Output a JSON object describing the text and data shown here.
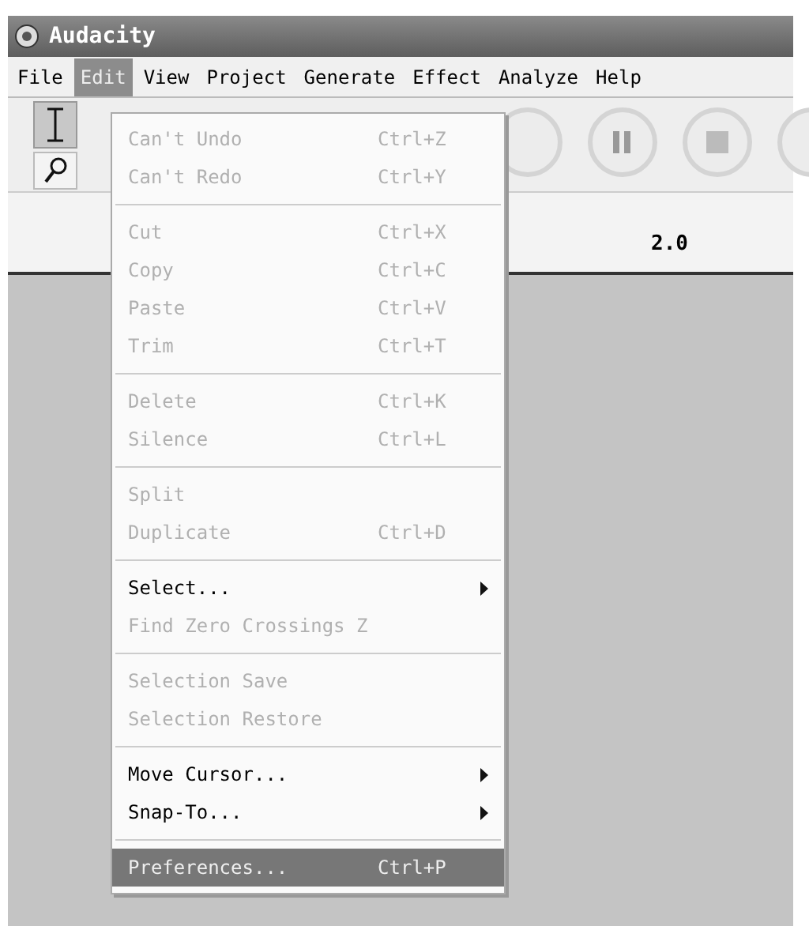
{
  "window": {
    "title": "Audacity"
  },
  "menu_bar": [
    {
      "label": "File",
      "selected": false
    },
    {
      "label": "Edit",
      "selected": true
    },
    {
      "label": "View",
      "selected": false
    },
    {
      "label": "Project",
      "selected": false
    },
    {
      "label": "Generate",
      "selected": false
    },
    {
      "label": "Effect",
      "selected": false
    },
    {
      "label": "Analyze",
      "selected": false
    },
    {
      "label": "Help",
      "selected": false
    }
  ],
  "tools": [
    {
      "kind": "ibeam",
      "selected": true
    },
    {
      "kind": "zoom",
      "selected": false
    }
  ],
  "ruler": {
    "label": "2.0"
  },
  "edit_menu": [
    {
      "kind": "item",
      "label": "Can't Undo",
      "shortcut": "Ctrl+Z",
      "disabled": true,
      "submenu": false,
      "selected": false
    },
    {
      "kind": "item",
      "label": "Can't Redo",
      "shortcut": "Ctrl+Y",
      "disabled": true,
      "submenu": false,
      "selected": false
    },
    {
      "kind": "separator"
    },
    {
      "kind": "item",
      "label": "Cut",
      "shortcut": "Ctrl+X",
      "disabled": true,
      "submenu": false,
      "selected": false
    },
    {
      "kind": "item",
      "label": "Copy",
      "shortcut": "Ctrl+C",
      "disabled": true,
      "submenu": false,
      "selected": false
    },
    {
      "kind": "item",
      "label": "Paste",
      "shortcut": "Ctrl+V",
      "disabled": true,
      "submenu": false,
      "selected": false
    },
    {
      "kind": "item",
      "label": "Trim",
      "shortcut": "Ctrl+T",
      "disabled": true,
      "submenu": false,
      "selected": false
    },
    {
      "kind": "separator"
    },
    {
      "kind": "item",
      "label": "Delete",
      "shortcut": "Ctrl+K",
      "disabled": true,
      "submenu": false,
      "selected": false
    },
    {
      "kind": "item",
      "label": "Silence",
      "shortcut": "Ctrl+L",
      "disabled": true,
      "submenu": false,
      "selected": false
    },
    {
      "kind": "separator"
    },
    {
      "kind": "item",
      "label": "Split",
      "disabled": true,
      "submenu": false,
      "selected": false
    },
    {
      "kind": "item",
      "label": "Duplicate",
      "shortcut": "Ctrl+D",
      "disabled": true,
      "submenu": false,
      "selected": false
    },
    {
      "kind": "separator"
    },
    {
      "kind": "item",
      "label": "Select...",
      "disabled": false,
      "submenu": true,
      "selected": false
    },
    {
      "kind": "item",
      "label": "Find Zero Crossings Z",
      "disabled": true,
      "submenu": false,
      "selected": false
    },
    {
      "kind": "separator"
    },
    {
      "kind": "item",
      "label": "Selection Save",
      "disabled": true,
      "submenu": false,
      "selected": false
    },
    {
      "kind": "item",
      "label": "Selection Restore",
      "disabled": true,
      "submenu": false,
      "selected": false
    },
    {
      "kind": "separator"
    },
    {
      "kind": "item",
      "label": "Move Cursor...",
      "disabled": false,
      "submenu": true,
      "selected": false
    },
    {
      "kind": "item",
      "label": "Snap-To...",
      "disabled": false,
      "submenu": true,
      "selected": false
    },
    {
      "kind": "separator"
    },
    {
      "kind": "item",
      "label": "Preferences...",
      "shortcut": "Ctrl+P",
      "disabled": false,
      "submenu": false,
      "selected": true
    }
  ]
}
